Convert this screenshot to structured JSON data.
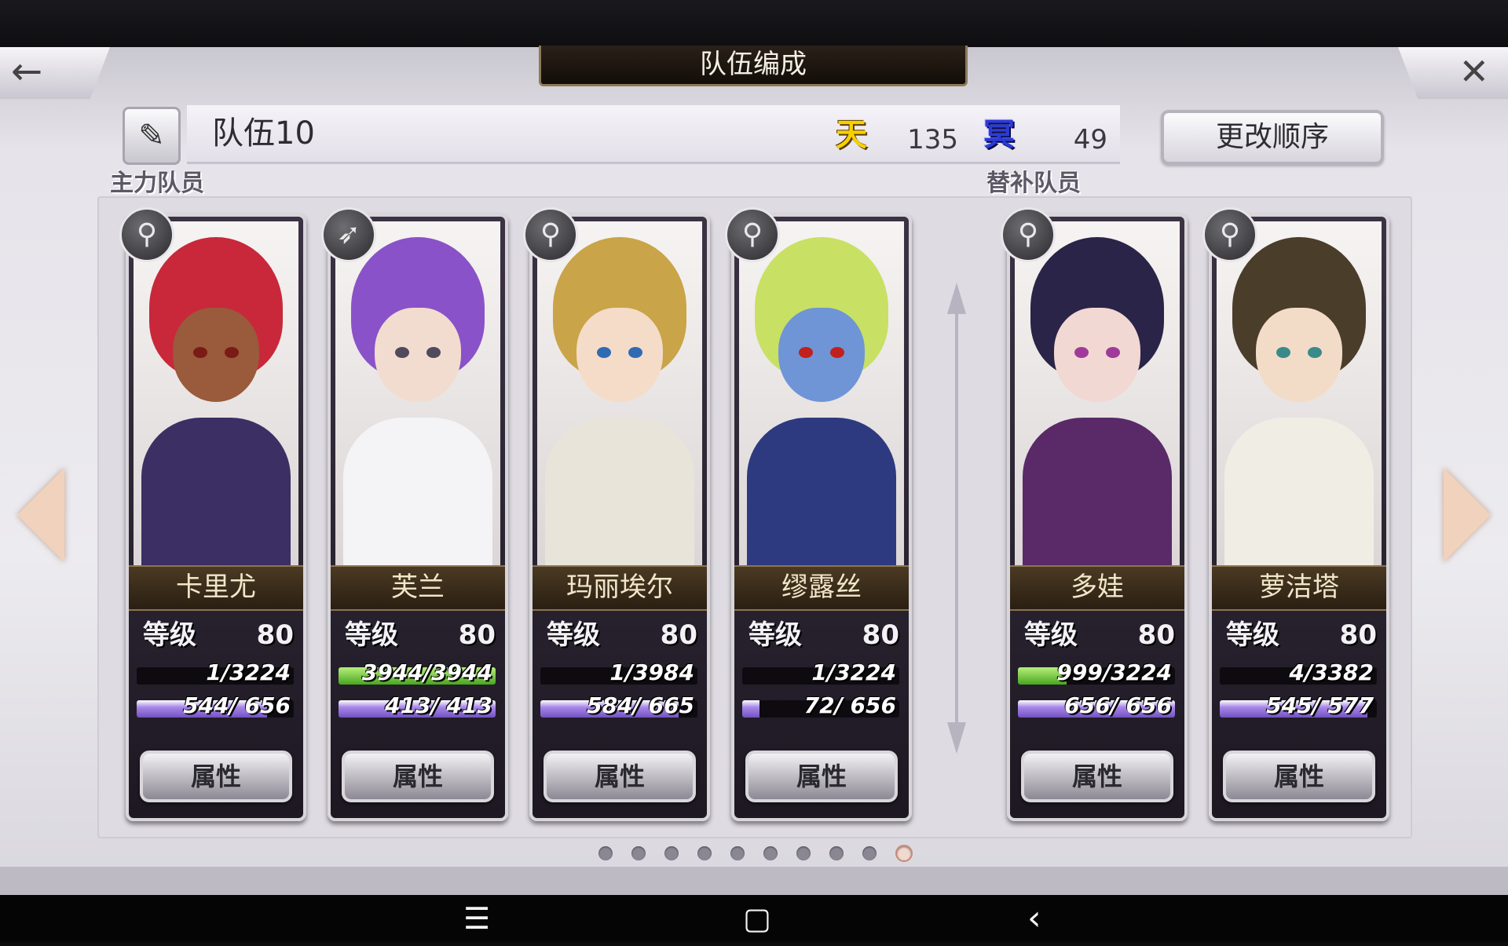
{
  "header": {
    "title": "队伍编成",
    "back_icon": "←",
    "close_icon": "✕"
  },
  "team": {
    "name": "队伍10",
    "edit_icon": "✎",
    "sky_label": "天",
    "sky_value": "135",
    "dark_label": "冥",
    "dark_value": "49",
    "order_button": "更改顺序"
  },
  "sections": {
    "main": "主力队员",
    "reserve": "替补队员"
  },
  "common": {
    "level_label": "等级",
    "attr_button": "属性"
  },
  "members": [
    {
      "name": "卡里尤",
      "level": "80",
      "exp_text": "1/3224",
      "exp_ratio": 0.0003,
      "hp_text": "544/ 656",
      "hp_ratio": 0.83,
      "class_icon": "staff-icon",
      "glyph": "⚲",
      "hair": "#c8283a",
      "skin": "#9a5a3c",
      "body": "#3b2f64",
      "eye": "#7a1b16"
    },
    {
      "name": "芙兰",
      "level": "80",
      "exp_text": "3944/3944",
      "exp_ratio": 1.0,
      "hp_text": "413/ 413",
      "hp_ratio": 1.0,
      "class_icon": "spear-icon",
      "glyph": "➶",
      "hair": "#8a52c8",
      "skin": "#f1dccf",
      "body": "#f4f4f6",
      "eye": "#514a5c"
    },
    {
      "name": "玛丽埃尔",
      "level": "80",
      "exp_text": "1/3984",
      "exp_ratio": 0.0003,
      "hp_text": "584/ 665",
      "hp_ratio": 0.88,
      "class_icon": "staff-icon",
      "glyph": "⚲",
      "hair": "#c9a448",
      "skin": "#f4dcc8",
      "body": "#e8e4da",
      "eye": "#2f6bb3"
    },
    {
      "name": "缪露丝",
      "level": "80",
      "exp_text": "1/3224",
      "exp_ratio": 0.0003,
      "hp_text": "72/ 656",
      "hp_ratio": 0.11,
      "class_icon": "staff-icon",
      "glyph": "⚲",
      "hair": "#c8e064",
      "skin": "#6f95d6",
      "body": "#2d3a80",
      "eye": "#c2201c"
    },
    {
      "name": "多娃",
      "level": "80",
      "exp_text": "999/3224",
      "exp_ratio": 0.31,
      "hp_text": "656/ 656",
      "hp_ratio": 1.0,
      "class_icon": "staff-icon",
      "glyph": "⚲",
      "hair": "#2a2448",
      "skin": "#f2d8d2",
      "body": "#5a2a68",
      "eye": "#a03a9a"
    },
    {
      "name": "萝洁塔",
      "level": "80",
      "exp_text": "4/3382",
      "exp_ratio": 0.001,
      "hp_text": "545/ 577",
      "hp_ratio": 0.94,
      "class_icon": "staff-icon",
      "glyph": "⚲",
      "hair": "#4a3d2a",
      "skin": "#f2dcc8",
      "body": "#f0ede4",
      "eye": "#3a8a8a"
    }
  ],
  "pagination": {
    "count": 10,
    "active": 10
  },
  "navbar": {
    "menu_icon": "☰",
    "home_icon": "▢",
    "back_icon": "‹"
  }
}
